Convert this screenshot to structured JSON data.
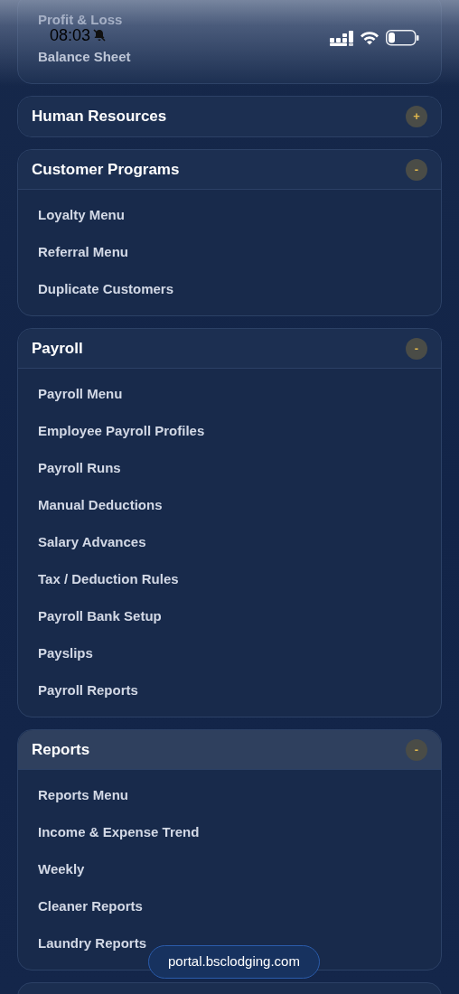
{
  "status_bar": {
    "time": "08:03"
  },
  "top_section": {
    "items": [
      "Profit & Loss",
      "Balance Sheet"
    ]
  },
  "sections": [
    {
      "title": "Human Resources",
      "toggle": "+",
      "expanded": false,
      "selected": false
    },
    {
      "title": "Customer Programs",
      "toggle": "-",
      "expanded": true,
      "selected": false,
      "items": [
        "Loyalty Menu",
        "Referral Menu",
        "Duplicate Customers"
      ]
    },
    {
      "title": "Payroll",
      "toggle": "-",
      "expanded": true,
      "selected": false,
      "items": [
        "Payroll Menu",
        "Employee Payroll Profiles",
        "Payroll Runs",
        "Manual Deductions",
        "Salary Advances",
        "Tax / Deduction Rules",
        "Payroll Bank Setup",
        "Payslips",
        "Payroll Reports"
      ]
    },
    {
      "title": "Reports",
      "toggle": "-",
      "expanded": true,
      "selected": true,
      "items": [
        "Reports Menu",
        "Income & Expense Trend",
        "Weekly",
        "Cleaner Reports",
        "Laundry Reports"
      ]
    }
  ],
  "url_bar": {
    "url": "portal.bsclodging.com"
  }
}
